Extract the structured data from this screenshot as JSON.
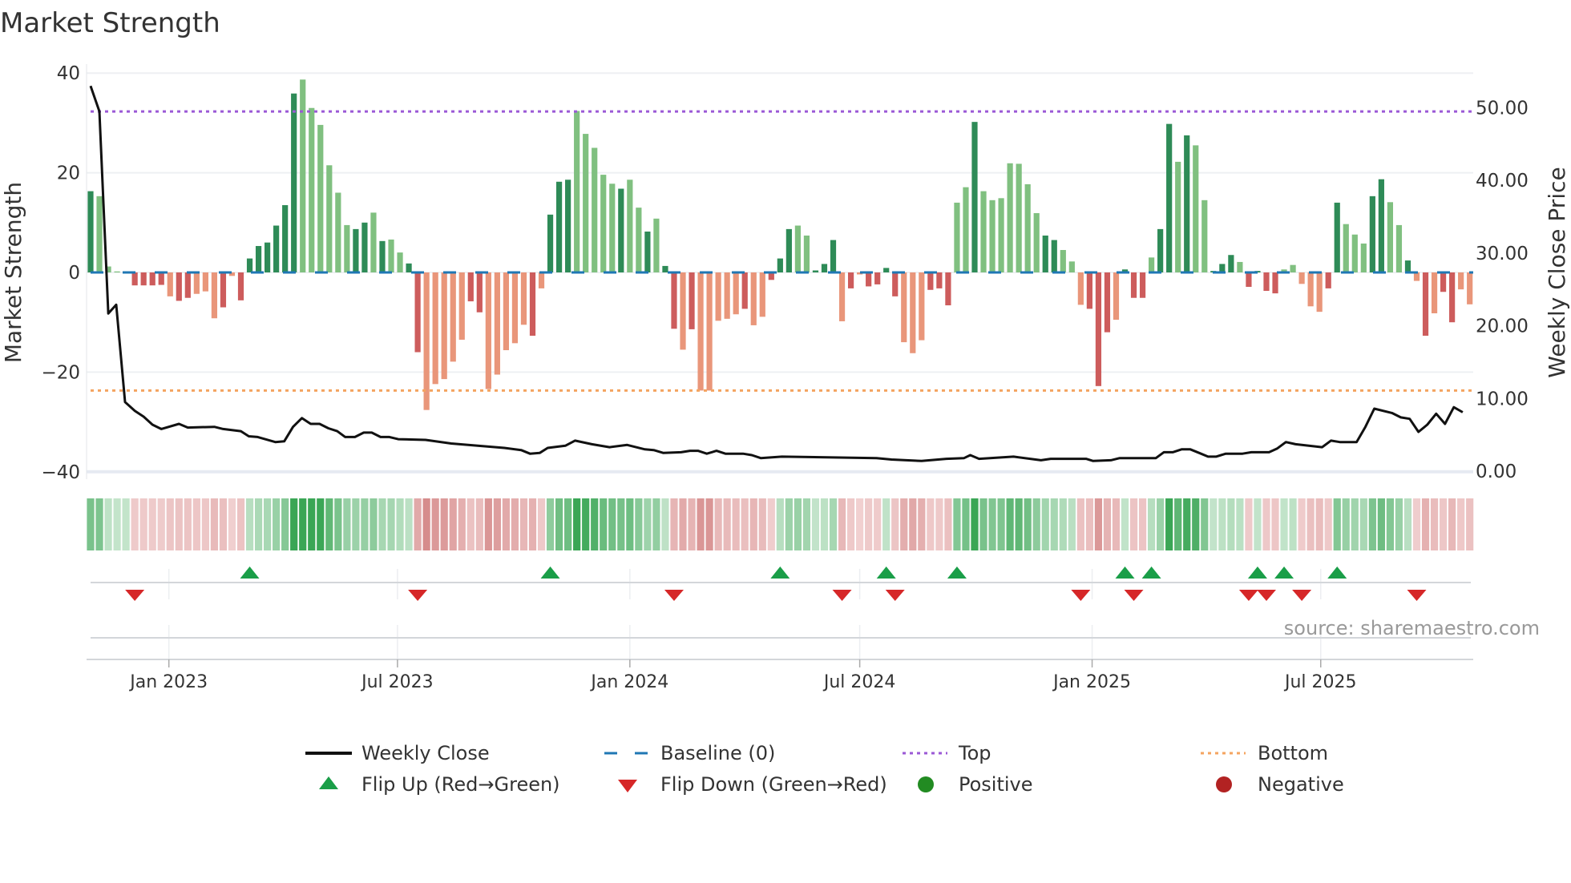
{
  "title": "Market Strength",
  "source": "source: sharemaestro.com",
  "chart_data": {
    "type": "bar",
    "title": "Market Strength",
    "xlabel": "",
    "ylabel": "Market Strength",
    "y2label": "Weekly Close Price",
    "ylim": [
      -40,
      40
    ],
    "y2lim": [
      0,
      54.7
    ],
    "yticks": [
      "40",
      "20",
      "0",
      "−20",
      "−40"
    ],
    "ytick_values": [
      40,
      20,
      0,
      -20,
      -40
    ],
    "y2ticks": [
      "50.00",
      "40.00",
      "30.00",
      "20.00",
      "10.00",
      "0.00"
    ],
    "y2tick_values": [
      50,
      40,
      30,
      20,
      10,
      0
    ],
    "start_week": "2022-10-31",
    "xticks": [
      {
        "label": "Jan 2023",
        "date": "2023-01-01"
      },
      {
        "label": "Jul 2023",
        "date": "2023-07-01"
      },
      {
        "label": "Jan 2024",
        "date": "2024-01-01"
      },
      {
        "label": "Jul 2024",
        "date": "2024-07-01"
      },
      {
        "label": "Jan 2025",
        "date": "2025-01-01"
      },
      {
        "label": "Jul 2025",
        "date": "2025-07-01"
      }
    ],
    "top_level": 32.3,
    "bottom_level": -23.7,
    "strength": [
      16.3,
      15.3,
      1.2,
      0.2,
      0.2,
      -2.6,
      -2.6,
      -2.6,
      -2.5,
      -4.8,
      -5.7,
      -5.1,
      -4.3,
      -3.8,
      -9.2,
      -7.0,
      -0.7,
      -5.6,
      2.8,
      5.3,
      6.0,
      9.4,
      13.5,
      35.9,
      38.7,
      33.0,
      29.6,
      21.5,
      16.0,
      9.5,
      8.7,
      10.0,
      12.0,
      6.3,
      6.6,
      4.0,
      1.8,
      -16.0,
      -27.6,
      -22.4,
      -21.4,
      -17.9,
      -13.5,
      -5.8,
      -8.0,
      -23.4,
      -20.5,
      -15.6,
      -14.2,
      -10.5,
      -12.7,
      -3.2,
      11.6,
      18.2,
      18.6,
      32.4,
      27.8,
      25.0,
      19.6,
      17.8,
      16.8,
      18.6,
      13.0,
      8.2,
      10.8,
      1.3,
      -11.3,
      -15.5,
      -11.4,
      -23.7,
      -23.7,
      -9.7,
      -9.3,
      -8.4,
      -7.3,
      -10.6,
      -8.9,
      -1.5,
      2.8,
      8.7,
      9.4,
      7.4,
      0.4,
      1.7,
      6.5,
      -9.8,
      -3.2,
      -0.4,
      -2.8,
      -2.4,
      0.9,
      -4.8,
      -14.0,
      -16.2,
      -13.6,
      -3.5,
      -3.2,
      -6.6,
      14.0,
      17.1,
      30.2,
      16.3,
      14.5,
      14.9,
      21.9,
      21.8,
      17.7,
      11.9,
      7.4,
      6.5,
      4.5,
      2.2,
      -6.5,
      -7.3,
      -22.8,
      -12.0,
      -9.5,
      0.6,
      -5.1,
      -5.1,
      3.0,
      8.7,
      29.8,
      22.2,
      27.5,
      25.5,
      14.5,
      0.3,
      1.7,
      3.5,
      2.1,
      -2.9,
      0.3,
      -3.7,
      -4.2,
      0.6,
      1.5,
      -2.3,
      -6.8,
      -7.9,
      -3.2,
      14.0,
      9.7,
      7.6,
      5.8,
      15.3,
      18.7,
      14.1,
      9.5,
      2.4,
      -1.7,
      -12.7,
      -8.2,
      -3.9,
      -10.0,
      -3.4,
      -6.4
    ],
    "strong": "dllllddddlddllldldddddddllllllddldllddlllllddllllldldddllllldlldlddldllllldlldddlldddldlddddllldddlldlllllllddllldddldddlddldlldddlddddlllllddlllddlldldldd",
    "weekly_close": [
      [
        0,
        53.0
      ],
      [
        1,
        49.5
      ],
      [
        2,
        21.7
      ],
      [
        2.9,
        22.9
      ],
      [
        3.9,
        9.5
      ],
      [
        5,
        8.3
      ],
      [
        6,
        7.5
      ],
      [
        7,
        6.4
      ],
      [
        8,
        5.8
      ],
      [
        10,
        6.5
      ],
      [
        11,
        6.0
      ],
      [
        14,
        6.1
      ],
      [
        15,
        5.8
      ],
      [
        17,
        5.5
      ],
      [
        17.9,
        4.8
      ],
      [
        18.9,
        4.7
      ],
      [
        20.9,
        4.0
      ],
      [
        21.9,
        4.1
      ],
      [
        22.9,
        6.1
      ],
      [
        23.9,
        7.3
      ],
      [
        24.9,
        6.5
      ],
      [
        25.9,
        6.5
      ],
      [
        26.9,
        5.9
      ],
      [
        27.9,
        5.5
      ],
      [
        28.8,
        4.7
      ],
      [
        29.9,
        4.7
      ],
      [
        30.9,
        5.3
      ],
      [
        31.8,
        5.3
      ],
      [
        32.8,
        4.7
      ],
      [
        33.8,
        4.7
      ],
      [
        34.8,
        4.4
      ],
      [
        37.9,
        4.3
      ],
      [
        40.8,
        3.8
      ],
      [
        43.8,
        3.5
      ],
      [
        46.8,
        3.2
      ],
      [
        48.7,
        2.9
      ],
      [
        49.7,
        2.4
      ],
      [
        50.8,
        2.5
      ],
      [
        51.7,
        3.2
      ],
      [
        53.7,
        3.5
      ],
      [
        54.8,
        4.2
      ],
      [
        56.7,
        3.7
      ],
      [
        58.7,
        3.3
      ],
      [
        60.7,
        3.6
      ],
      [
        62.7,
        3.0
      ],
      [
        63.7,
        2.9
      ],
      [
        64.8,
        2.5
      ],
      [
        66.8,
        2.6
      ],
      [
        67.8,
        2.8
      ],
      [
        68.7,
        2.8
      ],
      [
        69.7,
        2.4
      ],
      [
        70.8,
        2.8
      ],
      [
        71.8,
        2.4
      ],
      [
        73.8,
        2.4
      ],
      [
        74.8,
        2.2
      ],
      [
        75.8,
        1.8
      ],
      [
        78.2,
        2.0
      ],
      [
        88.9,
        1.8
      ],
      [
        90.6,
        1.6
      ],
      [
        94,
        1.4
      ],
      [
        96.8,
        1.7
      ],
      [
        98.8,
        1.8
      ],
      [
        99.5,
        2.2
      ],
      [
        100.5,
        1.7
      ],
      [
        104.4,
        2.0
      ],
      [
        107.5,
        1.5
      ],
      [
        108.6,
        1.7
      ],
      [
        112.6,
        1.7
      ],
      [
        113.4,
        1.4
      ],
      [
        115.4,
        1.5
      ],
      [
        116.4,
        1.8
      ],
      [
        120.5,
        1.8
      ],
      [
        121.4,
        2.6
      ],
      [
        122.4,
        2.6
      ],
      [
        123.4,
        3.0
      ],
      [
        124.4,
        3.0
      ],
      [
        125.4,
        2.5
      ],
      [
        126.4,
        2.0
      ],
      [
        127.3,
        2.0
      ],
      [
        128.4,
        2.4
      ],
      [
        130.3,
        2.4
      ],
      [
        131.3,
        2.6
      ],
      [
        133.3,
        2.6
      ],
      [
        134.2,
        3.1
      ],
      [
        135.2,
        4.0
      ],
      [
        136.3,
        3.7
      ],
      [
        139.3,
        3.3
      ],
      [
        140.3,
        4.2
      ],
      [
        141.3,
        4.0
      ],
      [
        143.2,
        4.0
      ],
      [
        144.2,
        6.1
      ],
      [
        145.2,
        8.6
      ],
      [
        147.2,
        8.0
      ],
      [
        148.2,
        7.4
      ],
      [
        149.2,
        7.2
      ],
      [
        150.2,
        5.4
      ],
      [
        151.2,
        6.4
      ],
      [
        152.2,
        7.9
      ],
      [
        153.2,
        6.5
      ],
      [
        154.2,
        8.8
      ],
      [
        155.2,
        8.1
      ]
    ],
    "flip_up_weeks": [
      18,
      52,
      78,
      90,
      98,
      117,
      120,
      132,
      135,
      141
    ],
    "flip_down_weeks": [
      5,
      37,
      66,
      85,
      91,
      112,
      118,
      131,
      133,
      137,
      150
    ],
    "legend": {
      "placement": "bottom",
      "items": [
        {
          "label": "Weekly Close",
          "kind": "line"
        },
        {
          "label": "Baseline (0)",
          "kind": "dash"
        },
        {
          "label": "Top",
          "kind": "dot-purple"
        },
        {
          "label": "Bottom",
          "kind": "dot-orange"
        },
        {
          "label": "Flip Up (Red→Green)",
          "kind": "tri-up"
        },
        {
          "label": "Flip Down (Green→Red)",
          "kind": "tri-down"
        },
        {
          "label": "Positive",
          "kind": "dot-green"
        },
        {
          "label": "Negative",
          "kind": "dot-red"
        }
      ]
    },
    "colors": {
      "pos_strong": "#2e8b57",
      "pos_light": "#80c080",
      "neg_strong": "#cd5c5c",
      "neg_light": "#e9967a",
      "baseline": "#1f77b4",
      "top": "#9b59d6",
      "bottom": "#f4a460",
      "close": "#111111",
      "flip_up": "#1a9e48",
      "flip_down": "#d62728",
      "positive": "#228b22",
      "negative": "#b22222"
    }
  }
}
